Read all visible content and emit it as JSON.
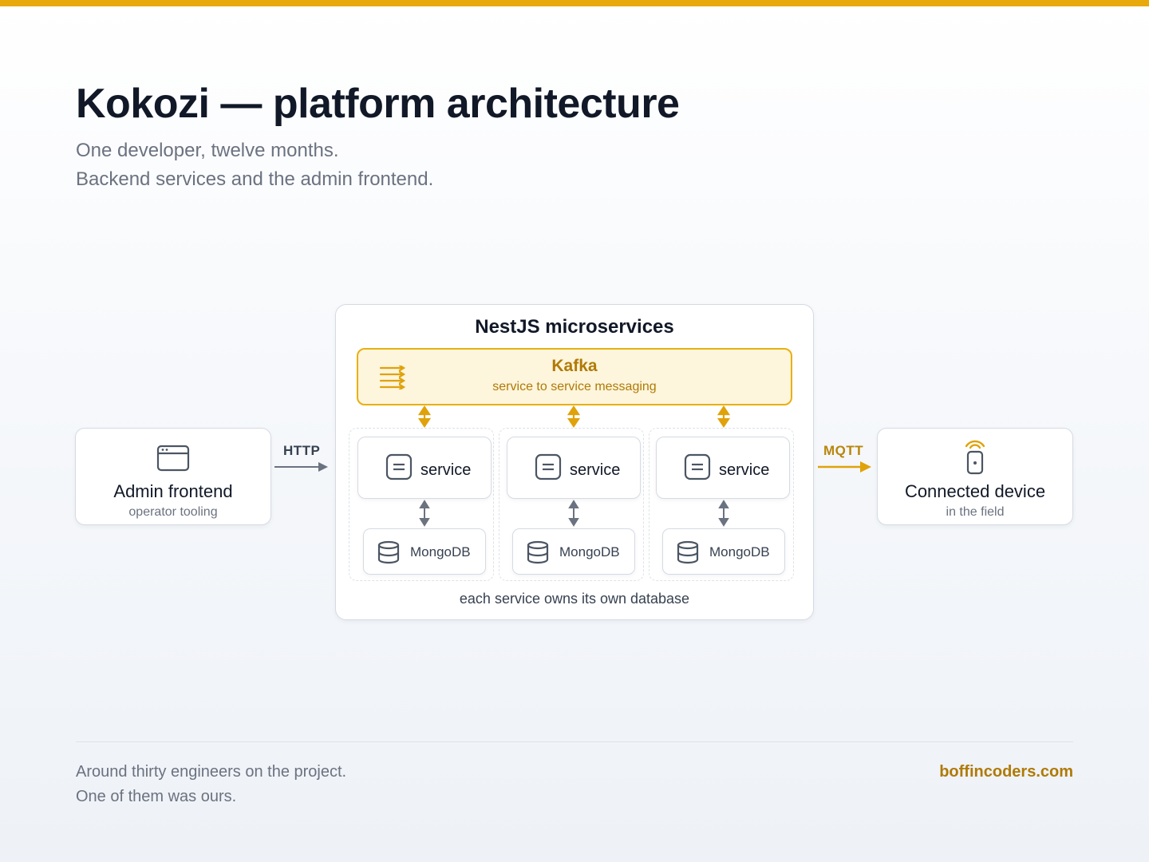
{
  "header": {
    "title": "Kokozi — platform architecture",
    "subtitle_line1": "One developer, twelve months.",
    "subtitle_line2": "Backend services and the admin frontend."
  },
  "admin_frontend": {
    "title": "Admin frontend",
    "subtitle": "operator tooling",
    "icon": "browser-window-icon"
  },
  "http_label": "HTTP",
  "mqtt_label": "MQTT",
  "connected_device": {
    "title": "Connected device",
    "subtitle": "in the field",
    "icon": "wireless-device-icon"
  },
  "microservices": {
    "title": "NestJS microservices",
    "kafka": {
      "title": "Kafka",
      "subtitle": "service to service messaging",
      "icon": "stream-lines-icon"
    },
    "services": [
      {
        "label": "service",
        "db_label": "MongoDB"
      },
      {
        "label": "service",
        "db_label": "MongoDB"
      },
      {
        "label": "service",
        "db_label": "MongoDB"
      }
    ],
    "footer": "each service owns its own database"
  },
  "footer": {
    "line1": "Around thirty engineers on the project.",
    "line2": "One of them was ours.",
    "brand": "boffincoders.com"
  },
  "colors": {
    "accent": "#e8a90c",
    "accent_text": "#b07a05",
    "kafka_fill": "#fdf5dc",
    "text_dark": "#111827",
    "text_muted": "#6b7280",
    "border": "#d5dbe3"
  }
}
